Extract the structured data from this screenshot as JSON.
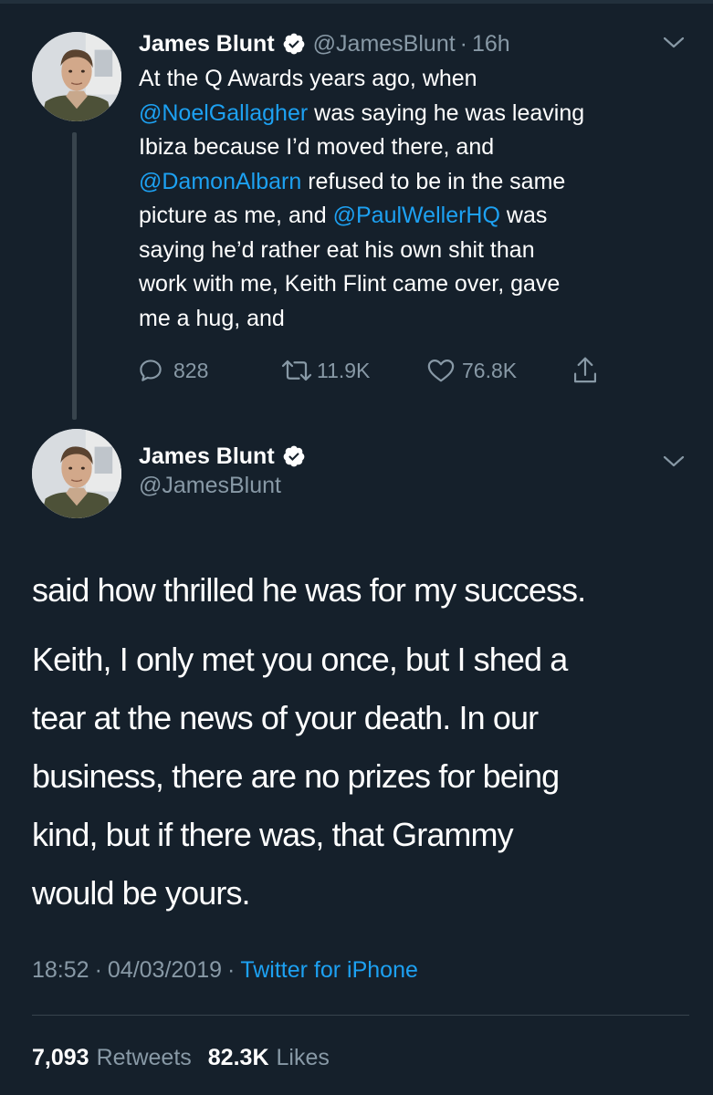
{
  "tweet1": {
    "author_name": "James Blunt",
    "author_handle": "@JamesBlunt",
    "separator": "·",
    "time": "16h",
    "text_lines": [
      [
        {
          "t": "At the Q Awards years ago, when",
          "m": false
        }
      ],
      [
        {
          "t": "@NoelGallagher",
          "m": true
        },
        {
          "t": " was saying he was leaving",
          "m": false
        }
      ],
      [
        {
          "t": "Ibiza because I’d moved there, and",
          "m": false
        }
      ],
      [
        {
          "t": "@DamonAlbarn",
          "m": true
        },
        {
          "t": " refused to be in the same",
          "m": false
        }
      ],
      [
        {
          "t": "picture as me, and ",
          "m": false
        },
        {
          "t": "@PaulWellerHQ",
          "m": true
        },
        {
          "t": " was",
          "m": false
        }
      ],
      [
        {
          "t": "saying he’d rather eat his own shit than",
          "m": false
        }
      ],
      [
        {
          "t": "work with me, Keith Flint came over, gave",
          "m": false
        }
      ],
      [
        {
          "t": "me a hug, and",
          "m": false
        }
      ]
    ],
    "reply_count": "828",
    "retweet_count": "11.9K",
    "like_count": "76.8K",
    "icons": {
      "reply": "reply-icon",
      "retweet": "retweet-icon",
      "like": "heart-icon",
      "share": "share-icon",
      "menu": "chevron-down-icon",
      "verified": "verified-badge-icon"
    }
  },
  "tweet2": {
    "author_name": "James Blunt",
    "author_handle": "@JamesBlunt",
    "paragraph1": "said how thrilled he was for my success.",
    "paragraph2_lines": [
      "Keith, I only met you once, but I shed a",
      "tear at the news of your death. In our",
      "business, there are no prizes for being",
      "kind, but if there was, that Grammy",
      "would be yours."
    ],
    "time": "18:52",
    "date": "04/03/2019",
    "separator": "·",
    "source": "Twitter for iPhone",
    "retweets": "7,093",
    "retweets_label": "Retweets",
    "likes": "82.3K",
    "likes_label": "Likes"
  },
  "colors": {
    "background": "#15202b",
    "text": "#ffffff",
    "secondary": "#8899a6",
    "accent": "#1da1f2",
    "divider": "#38444d"
  }
}
